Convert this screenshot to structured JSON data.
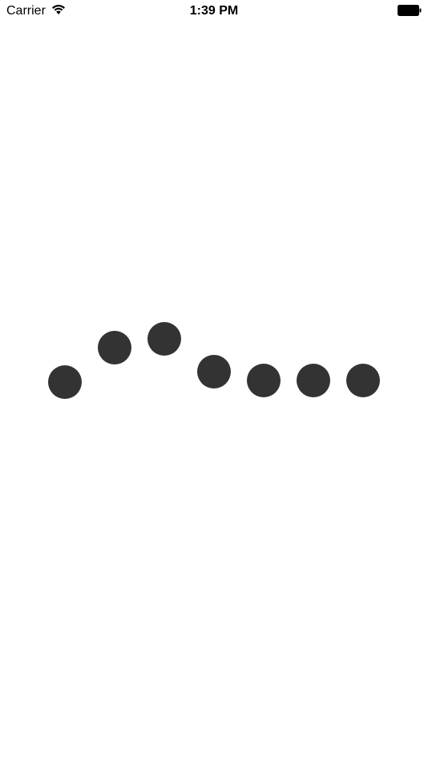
{
  "status_bar": {
    "carrier": "Carrier",
    "time": "1:39 PM",
    "wifi_icon": "wifi-icon",
    "battery_icon": "battery-icon"
  },
  "loader": {
    "dot_color": "#333333",
    "dot_count": 7
  },
  "colors": {
    "background": "#ffffff",
    "text": "#000000"
  }
}
